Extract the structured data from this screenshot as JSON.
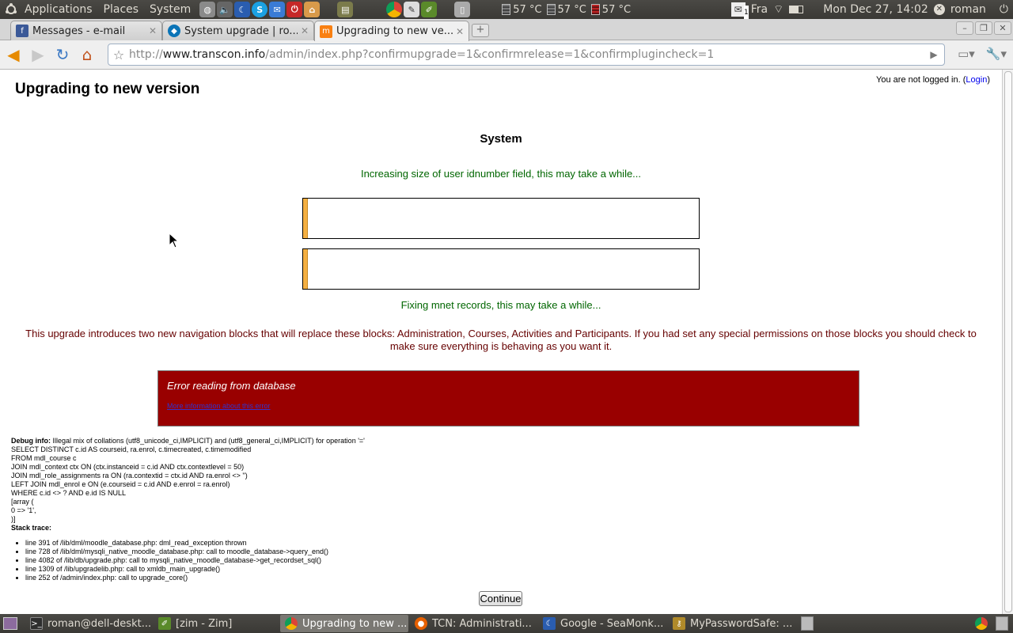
{
  "top_panel": {
    "menus": [
      "Applications",
      "Places",
      "System"
    ],
    "temps": [
      "57 °C",
      "57 °C",
      "57 °C"
    ],
    "keyboard": "Fra",
    "notification_count": "1",
    "clock": "Mon Dec 27, 14:02",
    "user": "roman"
  },
  "browser": {
    "tabs": [
      {
        "label": "Messages - e-mail"
      },
      {
        "label": "System upgrade | ro..."
      },
      {
        "label": "Upgrading to new ve..."
      }
    ],
    "url_host": "www.transcon.info",
    "url_scheme": "http://",
    "url_path": "/admin/index.php?confirmupgrade=1&confirmrelease=1&confirmplugincheck=1"
  },
  "page": {
    "login_prefix": "You are not logged in. (",
    "login_link": "Login",
    "login_suffix": ")",
    "title": "Upgrading to new version",
    "section_heading": "System",
    "notice_1": "Increasing size of user idnumber field, this may take a while...",
    "progress_1": 0.01,
    "progress_2": 0.01,
    "notice_2": "Fixing mnet records, this may take a while...",
    "warning": "This upgrade introduces two new navigation blocks that will replace these blocks: Administration, Courses, Activities and Participants. If you had set any special permissions on those blocks you should check to make sure everything is behaving as you want it.",
    "error": {
      "message": "Error reading from database",
      "more_info": "More information about this error"
    },
    "debug": {
      "label": "Debug info:",
      "summary": "Illegal mix of collations (utf8_unicode_ci,IMPLICIT) and (utf8_general_ci,IMPLICIT) for operation '='",
      "sql": "SELECT DISTINCT c.id AS courseid, ra.enrol, c.timecreated, c.timemodified\nFROM mdl_course c\nJOIN mdl_context ctx ON (ctx.instanceid = c.id AND ctx.contextlevel = 50)\nJOIN mdl_role_assignments ra ON (ra.contextid = ctx.id AND ra.enrol <> '')\nLEFT JOIN mdl_enrol e ON (e.courseid = c.id AND e.enrol = ra.enrol)\nWHERE c.id <> ? AND e.id IS NULL\n[array (\n0 => '1',\n)]",
      "stack_label": "Stack trace:",
      "stack": [
        "line 391 of /lib/dml/moodle_database.php: dml_read_exception thrown",
        "line 728 of /lib/dml/mysqli_native_moodle_database.php: call to moodle_database->query_end()",
        "line 4082 of /lib/db/upgrade.php: call to mysqli_native_moodle_database->get_recordset_sql()",
        "line 1309 of /lib/upgradelib.php: call to xmldb_main_upgrade()",
        "line 252 of /admin/index.php: call to upgrade_core()"
      ]
    },
    "continue_label": "Continue"
  },
  "taskbar": [
    {
      "label": "roman@dell-deskt..."
    },
    {
      "label": "[zim - Zim]"
    },
    {
      "label": "Upgrading to new ..."
    },
    {
      "label": "TCN: Administrati..."
    },
    {
      "label": "Google - SeaMonk..."
    },
    {
      "label": "MyPasswordSafe: ..."
    }
  ],
  "colors": {
    "progress_fill": "#f5b042",
    "notice_ok": "#006600",
    "notice_warn": "#660000",
    "error_bg": "#990000"
  }
}
